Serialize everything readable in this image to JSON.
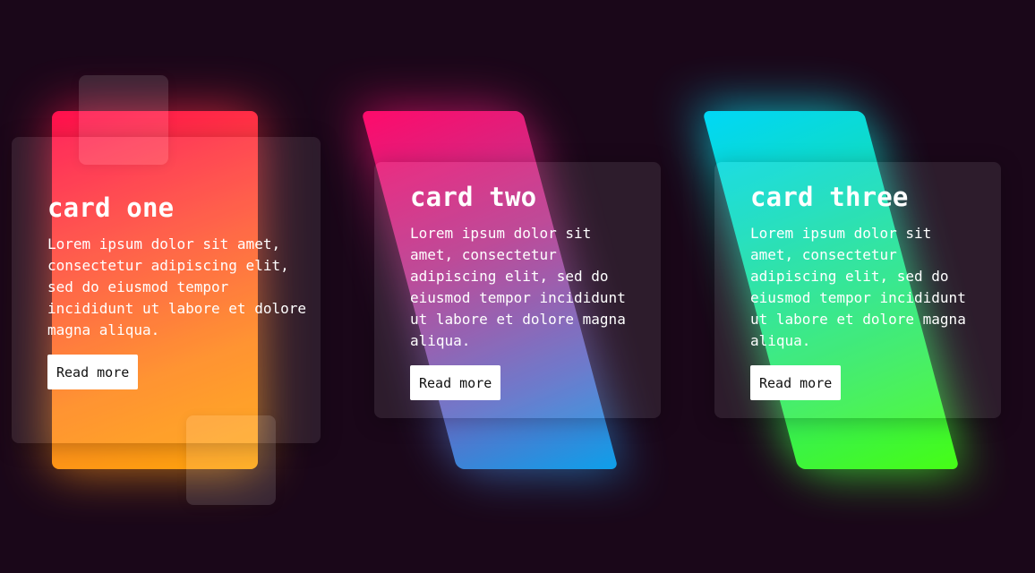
{
  "colors": {
    "background": "#1a0719",
    "card_one_gradient": [
      "#ff0f4e",
      "#ff4d3d",
      "#ff8a1f",
      "#ffa60d"
    ],
    "card_two_gradient": [
      "#ff0a6b",
      "#b83a8f",
      "#5f6fc8",
      "#0da0ea"
    ],
    "card_three_gradient": [
      "#00d7f7",
      "#13dcbc",
      "#35ec60",
      "#46fe15"
    ],
    "button_background": "#ffffff",
    "button_text": "#111111"
  },
  "cards": [
    {
      "title": "card one",
      "text": "Lorem ipsum dolor sit amet, consectetur adipiscing elit, sed do eiusmod tempor incididunt ut labore et dolore magna aliqua.",
      "button_label": "Read more"
    },
    {
      "title": "card two",
      "text": "Lorem ipsum dolor sit amet, consectetur adipiscing elit, sed do eiusmod tempor incididunt ut labore et dolore magna aliqua.",
      "button_label": "Read more"
    },
    {
      "title": "card three",
      "text": "Lorem ipsum dolor sit amet, consectetur adipiscing elit, sed do eiusmod tempor incididunt ut labore et dolore magna aliqua.",
      "button_label": "Read more"
    }
  ]
}
